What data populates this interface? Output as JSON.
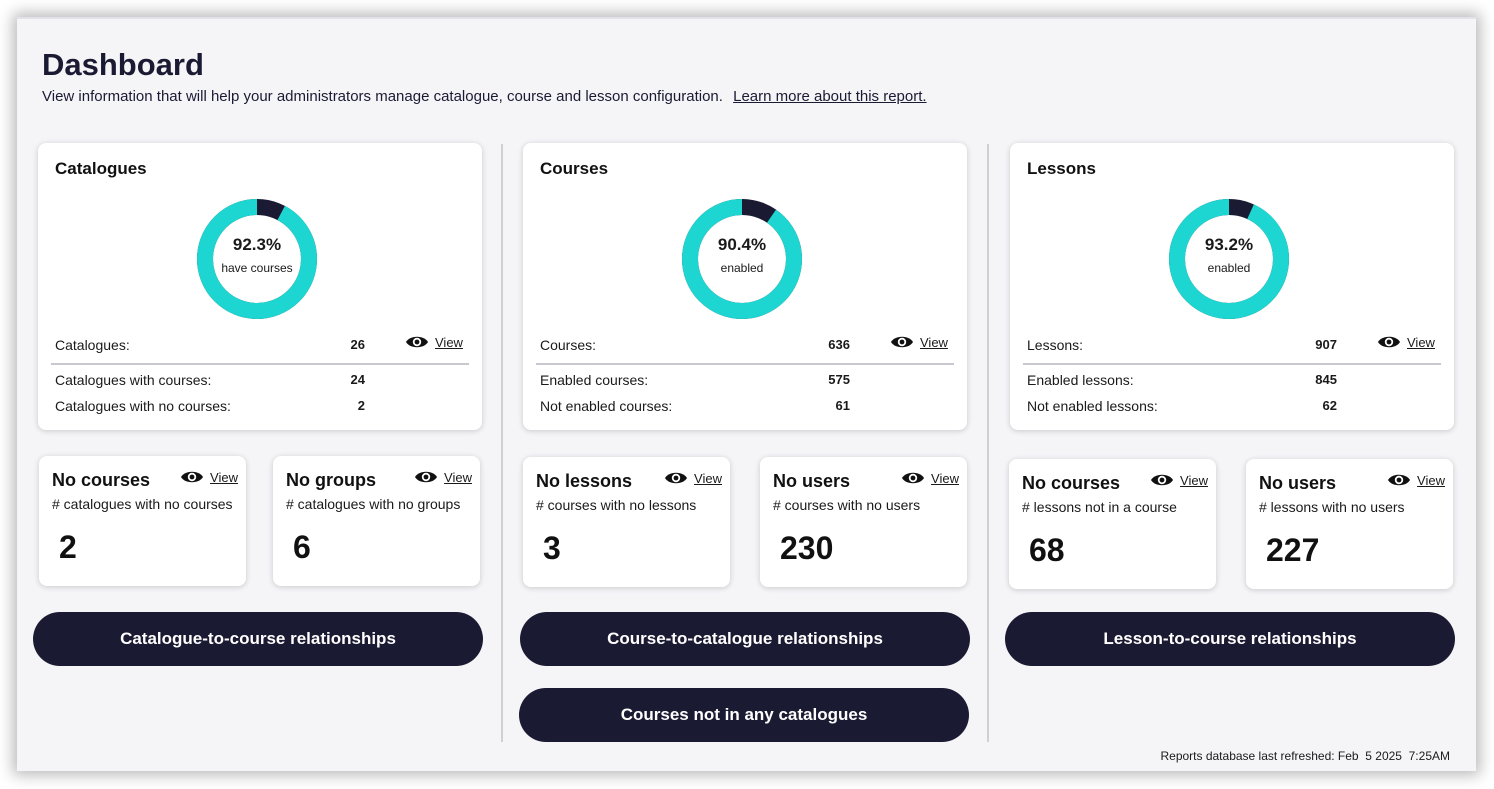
{
  "header": {
    "title": "Dashboard",
    "subtitle": "View information that will help your administrators manage catalogue, course and lesson configuration.",
    "learn_more": "Learn more about this report."
  },
  "colors": {
    "accent": "#1ed6d1",
    "dark": "#1b1a33",
    "background": "#f5f5f8"
  },
  "catalogues": {
    "title": "Catalogues",
    "donut": {
      "percent_label": "92.3%",
      "caption": "have courses",
      "fraction": 0.923
    },
    "total_label": "Catalogues:",
    "total_value": "26",
    "view": "View",
    "row1_label": "Catalogues with courses:",
    "row1_value": "24",
    "row2_label": "Catalogues with no courses:",
    "row2_value": "2",
    "card_a": {
      "title": "No courses",
      "desc": "# catalogues with no courses",
      "value": "2",
      "view": "View"
    },
    "card_b": {
      "title": "No groups",
      "desc": "# catalogues with no groups",
      "value": "6",
      "view": "View"
    },
    "button1": "Catalogue-to-course relationships"
  },
  "courses": {
    "title": "Courses",
    "donut": {
      "percent_label": "90.4%",
      "caption": "enabled",
      "fraction": 0.904
    },
    "total_label": "Courses:",
    "total_value": "636",
    "view": "View",
    "row1_label": "Enabled courses:",
    "row1_value": "575",
    "row2_label": "Not enabled courses:",
    "row2_value": "61",
    "card_a": {
      "title": "No lessons",
      "desc": "# courses with no lessons",
      "value": "3",
      "view": "View"
    },
    "card_b": {
      "title": "No users",
      "desc": "# courses with no users",
      "value": "230",
      "view": "View"
    },
    "button1": "Course-to-catalogue relationships",
    "button2": "Courses not in any catalogues"
  },
  "lessons": {
    "title": "Lessons",
    "donut": {
      "percent_label": "93.2%",
      "caption": "enabled",
      "fraction": 0.932
    },
    "total_label": "Lessons:",
    "total_value": "907",
    "view": "View",
    "row1_label": "Enabled lessons:",
    "row1_value": "845",
    "row2_label": "Not enabled lessons:",
    "row2_value": "62",
    "card_a": {
      "title": "No courses",
      "desc": "# lessons not in a course",
      "value": "68",
      "view": "View"
    },
    "card_b": {
      "title": "No users",
      "desc": "# lessons with no users",
      "value": "227",
      "view": "View"
    },
    "button1": "Lesson-to-course relationships"
  },
  "footer": {
    "refreshed": "Reports database last refreshed: Feb  5 2025  7:25AM"
  }
}
